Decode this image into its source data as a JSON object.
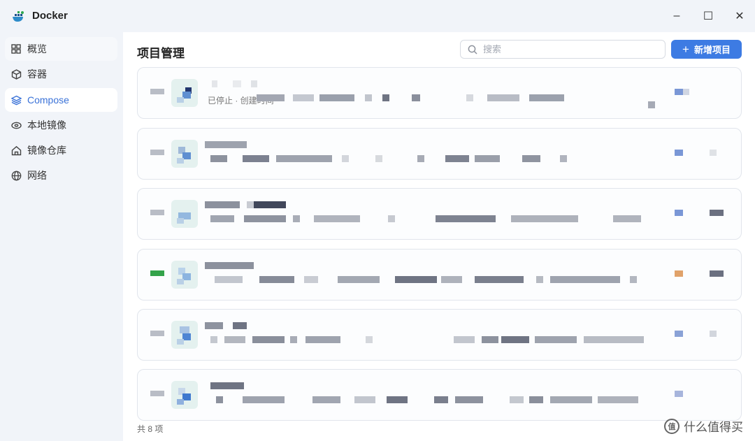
{
  "window": {
    "title": "Docker",
    "controls": {
      "minimize": "–",
      "maximize": "☐",
      "close": "✕"
    }
  },
  "sidebar": {
    "items": [
      {
        "label": "概览",
        "icon": "grid-icon"
      },
      {
        "label": "容器",
        "icon": "cube-icon"
      },
      {
        "label": "Compose",
        "icon": "layers-icon",
        "active": true
      },
      {
        "label": "本地镜像",
        "icon": "disk-icon"
      },
      {
        "label": "镜像仓库",
        "icon": "home-icon"
      },
      {
        "label": "网络",
        "icon": "globe-icon"
      }
    ]
  },
  "main": {
    "title": "项目管理",
    "search": {
      "placeholder": "搜索",
      "value": ""
    },
    "add_button": {
      "plus": "+",
      "label": "新增项目"
    },
    "projects": [
      {
        "status": "stopped",
        "description": "已停止 · 创建时间"
      },
      {
        "status": "stopped",
        "description": ""
      },
      {
        "status": "stopped",
        "description": ""
      },
      {
        "status": "running",
        "description": ""
      },
      {
        "status": "stopped",
        "description": ""
      },
      {
        "status": "stopped",
        "description": ""
      }
    ],
    "footer": "共 8 项"
  },
  "watermark": {
    "badge": "值",
    "text": "什么值得买"
  },
  "colors": {
    "accent": "#3d7be3",
    "running": "#34a34a",
    "stopped": "#b9bdc6",
    "sidebar_bg": "#f1f4f9"
  }
}
